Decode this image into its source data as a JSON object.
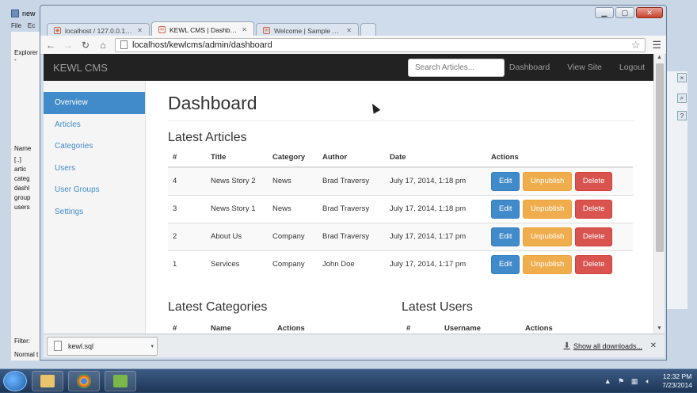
{
  "background_app": {
    "title_fragment": "new",
    "menu": [
      "File",
      "Ec"
    ],
    "panel_header": "Explorer -",
    "list_header": "Name",
    "items": [
      "[..]",
      "artic",
      "categ",
      "dashl",
      "group",
      "users"
    ],
    "filter_label": "Filter:",
    "status": "Normal t"
  },
  "browser": {
    "tabs": [
      {
        "title": "localhost / 127.0.0.1 / kew",
        "active": false,
        "icon": "pma-favicon"
      },
      {
        "title": "KEWL CMS | Dashboard",
        "active": true,
        "icon": "page-favicon"
      },
      {
        "title": "Welcome | Sample Site",
        "active": false,
        "icon": "page-favicon"
      }
    ],
    "url": "localhost/kewlcms/admin/dashboard"
  },
  "cms": {
    "brand": "KEWL CMS",
    "search_placeholder": "Search Articles...",
    "nav": [
      "Dashboard",
      "View Site",
      "Logout"
    ],
    "sidebar": [
      "Overview",
      "Articles",
      "Categories",
      "Users",
      "User Groups",
      "Settings"
    ],
    "page_title": "Dashboard",
    "articles_heading": "Latest Articles",
    "articles_columns": [
      "#",
      "Title",
      "Category",
      "Author",
      "Date",
      "Actions"
    ],
    "articles": [
      {
        "id": "4",
        "title": "News Story 2",
        "category": "News",
        "author": "Brad Traversy",
        "date": "July 17, 2014, 1:18 pm"
      },
      {
        "id": "3",
        "title": "News Story 1",
        "category": "News",
        "author": "Brad Traversy",
        "date": "July 17, 2014, 1:18 pm"
      },
      {
        "id": "2",
        "title": "About Us",
        "category": "Company",
        "author": "Brad Traversy",
        "date": "July 17, 2014, 1:17 pm"
      },
      {
        "id": "1",
        "title": "Services",
        "category": "Company",
        "author": "John Doe",
        "date": "July 17, 2014, 1:17 pm"
      }
    ],
    "buttons": {
      "edit": "Edit",
      "unpublish": "Unpublish",
      "delete": "Delete"
    },
    "categories_heading": "Latest Categories",
    "categories_columns": [
      "#",
      "Name",
      "Actions"
    ],
    "users_heading": "Latest Users",
    "users_columns": [
      "#",
      "Username",
      "Actions"
    ]
  },
  "downloads": {
    "file": "kewl.sql",
    "show_all": "Show all downloads..."
  },
  "taskbar": {
    "time": "12:32 PM",
    "date": "7/23/2014"
  },
  "colors": {
    "primary": "#428bca",
    "warning": "#f0ad4e",
    "danger": "#d9534f",
    "navbar": "#222222"
  }
}
